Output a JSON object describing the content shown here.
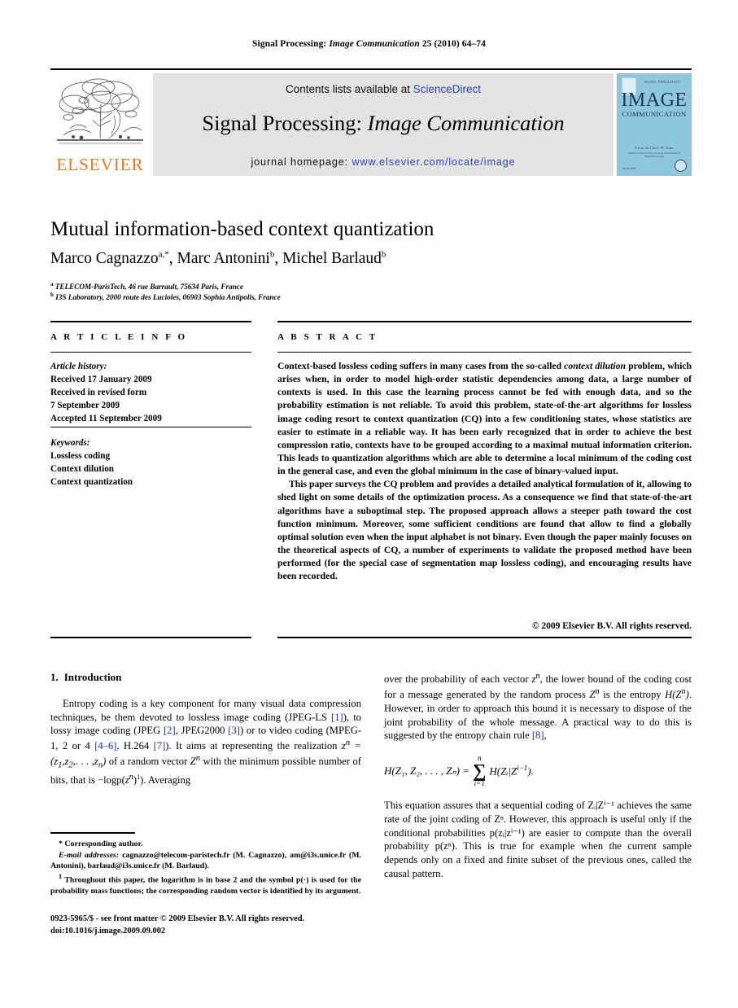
{
  "running_head": {
    "part1": "Signal Processing: ",
    "part2": "Image Communication",
    "part3": " 25 (2010) 64–74"
  },
  "banner": {
    "contents_prefix": "Contents lists available at ",
    "sciencedirect": "ScienceDirect",
    "journal_title_plain": "Signal Processing: ",
    "journal_title_italic": "Image Communication",
    "homepage_prefix": "journal homepage: ",
    "homepage_url": "www.elsevier.com/locate/image",
    "publisher": "ELSEVIER",
    "cover": {
      "kicker": "SIGNAL PROCESSING",
      "title": "IMAGE",
      "subtitle": "COMMUNICATION",
      "mid": "Editor-in-Chief: M. Kunt",
      "mid2": "Official Journal of the European Association for Signal Processing",
      "foot": "ELSEVIER"
    },
    "link_color": "#2a43b8",
    "elsevier_orange": "#E87722",
    "banner_bg": "#e3e3e3",
    "cover_bg": "#8ec6e0"
  },
  "article": {
    "title": "Mutual information-based context quantization",
    "authors": [
      {
        "name": "Marco Cagnazzo",
        "marks": "a,*"
      },
      {
        "name": "Marc Antonini",
        "marks": "b"
      },
      {
        "name": "Michel Barlaud",
        "marks": "b"
      }
    ],
    "affiliations": [
      {
        "mark": "a",
        "text": "TELECOM-ParisTech, 46 rue Barrault, 75634 Paris, France"
      },
      {
        "mark": "b",
        "text": "I3S Laboratory, 2000 route des Lucioles, 06903 Sophia Antipolis, France"
      }
    ]
  },
  "info": {
    "header": "A R T I C L E   I N F O",
    "history_label": "Article history:",
    "history": [
      "Received 17 January 2009",
      "Received in revised form",
      "7 September 2009",
      "Accepted 11 September 2009"
    ],
    "keywords_label": "Keywords:",
    "keywords": [
      "Lossless coding",
      "Context dilution",
      "Context quantization"
    ]
  },
  "abstract": {
    "header": "A B S T R A C T",
    "p1_a": "Context-based lossless coding suffers in many cases from the so-called ",
    "p1_italic": "context dilution",
    "p1_b": " problem, which arises when, in order to model high-order statistic dependencies among data, a large number of contexts is used. In this case the learning process cannot be fed with enough data, and so the probability estimation is not reliable. To avoid this problem, state-of-the-art algorithms for lossless image coding resort to context quantization (CQ) into a few conditioning states, whose statistics are easier to estimate in a reliable way. It has been early recognized that in order to achieve the best compression ratio, contexts have to be grouped according to a maximal mutual information criterion. This leads to quantization algorithms which are able to determine a local minimum of the coding cost in the general case, and even the global minimum in the case of binary-valued input.",
    "p2": "This paper surveys the CQ problem and provides a detailed analytical formulation of it, allowing to shed light on some details of the optimization process. As a consequence we find that state-of-the-art algorithms have a suboptimal step. The proposed approach allows a steeper path toward the cost function minimum. Moreover, some sufficient conditions are found that allow to find a globally optimal solution even when the input alphabet is not binary. Even though the paper mainly focuses on the theoretical aspects of CQ, a number of experiments to validate the proposed method have been performed (for the special case of segmentation map lossless coding), and encouraging results have been recorded.",
    "copyright": "© 2009 Elsevier B.V. All rights reserved."
  },
  "body": {
    "section_number": "1.",
    "section_title": "Introduction",
    "left_p1_1": "Entropy coding is a key component for many visual data compression techniques, be them devoted to lossless image coding (JPEG-LS ",
    "cite1": "[1]",
    "left_p1_2": "), to lossy image coding (JPEG ",
    "cite2": "[2]",
    "left_p1_3": ", JPEG2000 ",
    "cite3": "[3]",
    "left_p1_4": ") or to video coding (MPEG-1, 2 or 4 ",
    "cite4": "[4–6]",
    "left_p1_5": ", H.264 ",
    "cite5": "[7]",
    "left_p1_6": "). It aims at representing the realization ",
    "left_p1_math1": "z",
    "left_p1_7": " of a random vector ",
    "left_p1_8": " with the minimum possible number of bits, that is −logp(",
    "left_p1_9": "). Averaging",
    "right_p1_1": "over the probability of each vector ",
    "right_p1_2": ", the lower bound of the coding cost for a message generated by the random process ",
    "right_p1_3": " is the entropy ",
    "right_p1_4": ". However, in order to approach this bound it is necessary to dispose of the joint probability of the whole message. A practical way to do this is suggested by the entropy chain rule ",
    "cite8": "[8]",
    "right_p1_5": ",",
    "equation": {
      "lhs": "H(Z₁, Z₂, . . . , Zₙ) =",
      "sum_top": "n",
      "sum_glyph": "∑",
      "sum_bottom": "i=1",
      "rhs": "H(Zᵢ|Z",
      "rhs_exp": "i−1",
      "rhs_end": ")."
    },
    "right_p2": "This equation assures that a sequential coding of Zᵢ|Zⁱ⁻¹ achieves the same rate of the joint coding of Zⁿ. However, this approach is useful only if the conditional probabilities p(zᵢ|zⁱ⁻¹) are easier to compute than the overall probability p(zⁿ). This is true for example when the current sample depends only on a fixed and finite subset of the previous ones, called the causal pattern."
  },
  "footnotes": {
    "corresponding": "* Corresponding author.",
    "email_label": "E-mail addresses:",
    "emails": " cagnazzo@telecom-paristech.fr (M. Cagnazzo), am@i3s.unice.fr (M. Antonini), barlaud@i3s.unice.fr (M. Barlaud).",
    "fn1_marker": "1",
    "fn1": " Throughout this paper, the logarithm is in base 2 and the symbol p(·) is used for the probability mass functions; the corresponding random vector is identified by its argument."
  },
  "imprint": {
    "issn_line": "0923-5965/$ - see front matter © 2009 Elsevier B.V. All rights reserved.",
    "doi_line": "doi:10.1016/j.image.2009.09.002"
  }
}
